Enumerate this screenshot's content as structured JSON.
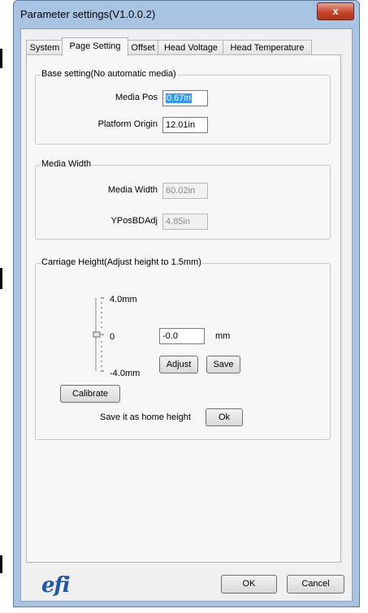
{
  "window": {
    "title": "Parameter settings(V1.0.0.2)",
    "close_glyph": "x"
  },
  "tabs": [
    {
      "label": "System"
    },
    {
      "label": "Page Setting"
    },
    {
      "label": "Offset"
    },
    {
      "label": "Head Voltage"
    },
    {
      "label": "Head Temperature"
    }
  ],
  "base_setting": {
    "legend": "Base setting(No automatic media)",
    "media_pos_label": "Media Pos",
    "media_pos_value": "0.67in",
    "platform_origin_label": "Platform Origin",
    "platform_origin_value": "12.01in"
  },
  "media_width": {
    "legend": "Media Width",
    "media_width_label": "Media Width",
    "media_width_value": "60.02in",
    "ypos_label": "YPosBDAdj",
    "ypos_value": "4.85in"
  },
  "carriage": {
    "legend": "Carriage Height(Adjust height to 1.5mm)",
    "tick_max": "4.0mm",
    "tick_mid": "0",
    "tick_min": "-4.0mm",
    "value": "-0.0",
    "unit": "mm",
    "adjust_label": "Adjust",
    "save_label": "Save",
    "calibrate_label": "Calibrate",
    "home_label": "Save it as home height",
    "ok_label": "Ok"
  },
  "footer": {
    "logo": "efi",
    "ok_label": "OK",
    "cancel_label": "Cancel"
  }
}
